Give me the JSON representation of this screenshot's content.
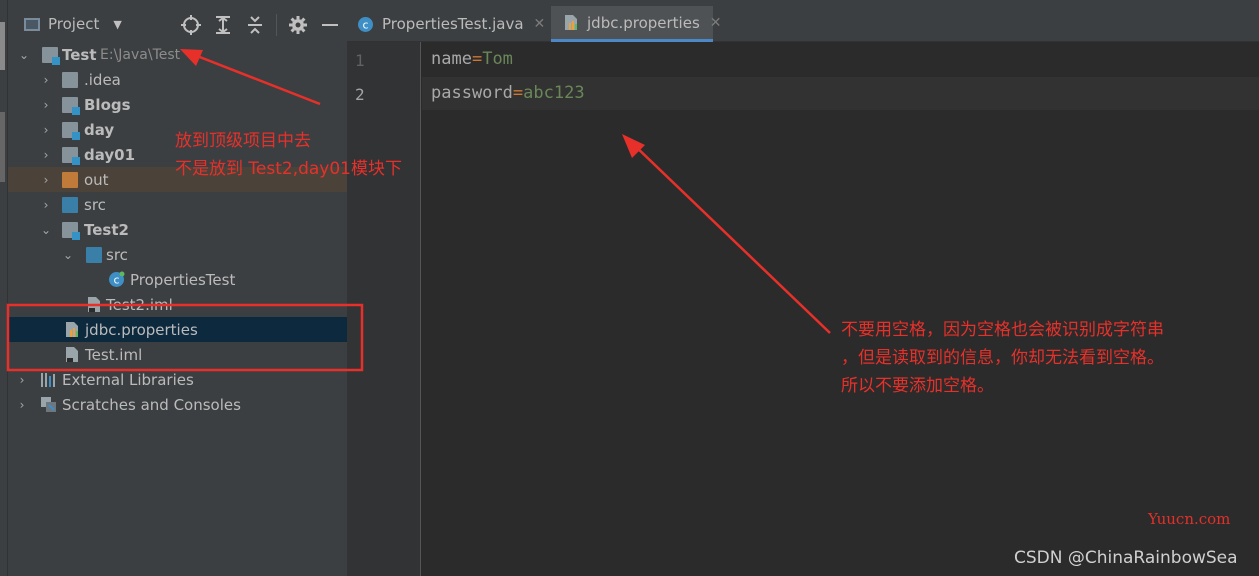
{
  "project_panel": {
    "title": "Project"
  },
  "tree": [
    {
      "label": "Test",
      "path": "E:\\Java\\Test",
      "bold": true
    },
    {
      "label": ".idea"
    },
    {
      "label": "Blogs",
      "bold": true
    },
    {
      "label": "day",
      "bold": true
    },
    {
      "label": "day01",
      "bold": true
    },
    {
      "label": "out"
    },
    {
      "label": "src"
    },
    {
      "label": "Test2",
      "bold": true
    },
    {
      "label": "src"
    },
    {
      "label": "PropertiesTest"
    },
    {
      "label": "Test2.iml"
    },
    {
      "label": "jdbc.properties"
    },
    {
      "label": "Test.iml"
    },
    {
      "label": "External Libraries"
    },
    {
      "label": "Scratches and Consoles"
    }
  ],
  "tabs": [
    {
      "label": "PropertiesTest.java",
      "active": false
    },
    {
      "label": "jdbc.properties",
      "active": true
    }
  ],
  "editor": {
    "lines": [
      {
        "number": "1",
        "key": "name",
        "eq": "=",
        "value": "Tom"
      },
      {
        "number": "2",
        "key": "password",
        "eq": "=",
        "value": "abc123"
      }
    ]
  },
  "annotations": {
    "top_line1": "放到顶级项目中去",
    "top_line2": "不是放到 Test2,day01模块下",
    "right_line1": "不要用空格，因为空格也会被识别成字符串",
    "right_line2": "，但是读取到的信息，你却无法看到空格。",
    "right_line3": "所以不要添加空格。"
  },
  "watermarks": {
    "site": "Yuucn.com",
    "author": "CSDN @ChinaRainbowSea"
  },
  "colors": {
    "annotation": "#e8302a",
    "selection": "#0d293e",
    "property_value": "#6a8759",
    "tab_underline": "#4a88c7"
  }
}
